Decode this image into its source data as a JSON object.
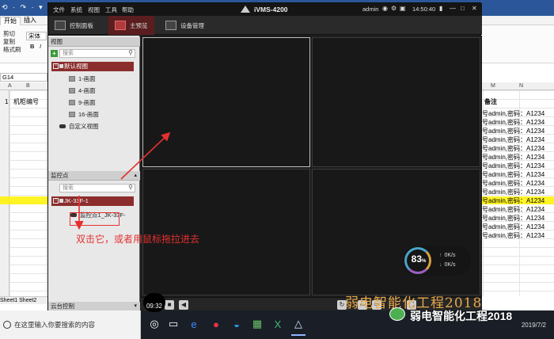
{
  "excel": {
    "quick_access": "⟲ · ↷ · ▾",
    "tabs": [
      "开始",
      "插入"
    ],
    "ribbon": {
      "cut": "剪切",
      "copy": "复制",
      "format_painter": "格式刷",
      "font": "宋体",
      "bold": "B",
      "italic": "I"
    },
    "name_box": "G14",
    "col_headers": [
      "A",
      "B",
      "M",
      "N"
    ],
    "cells": {
      "row1_no": "1",
      "row1_name": "机柜编号",
      "remark_header": "备注",
      "pw_rows": [
        "号admin,密码：A1234",
        "号admin,密码：A1234",
        "号admin,密码：A1234",
        "号admin,密码：A1234",
        "号admin,密码：A1234",
        "号admin,密码：A1234",
        "号admin,密码：A1234",
        "号admin,密码：A1234",
        "号admin,密码：A1234",
        "号admin,密码：A1234",
        "号admin,密码：A1234",
        "号admin,密码：A1234",
        "号admin,密码：A1234",
        "号admin,密码：A1234",
        "号admin,密码：A1234"
      ]
    },
    "sheets": [
      "Sheet1",
      "Sheet2"
    ]
  },
  "ivms": {
    "menus": [
      "文件",
      "系统",
      "视图",
      "工具",
      "帮助"
    ],
    "title": "iVMS-4200",
    "user": "admin",
    "time": "14:50:40",
    "tabs": [
      {
        "label": "控制面板"
      },
      {
        "label": "主预览"
      },
      {
        "label": "设备管理"
      }
    ],
    "view_section": {
      "header": "视图",
      "search_placeholder": "搜索",
      "root": "默认视图",
      "items": [
        "1-画面",
        "4-画面",
        "9-画面",
        "16-画面"
      ],
      "custom": "自定义视图"
    },
    "monitor_section": {
      "header": "监控点",
      "search_placeholder": "搜索",
      "root": "JK-33F-1",
      "item": "监控点1_JK-33F-"
    },
    "ptz_section": {
      "header": "云台控制"
    },
    "perf": {
      "percent": "83",
      "percent_unit": "%",
      "up": "0K/s",
      "down": "0K/s"
    }
  },
  "annotation": "双击它，或者用鼠标拖拉进去",
  "watermark": "弱电智能化工程2018",
  "watermark_brand": "弱电智能化工程2018",
  "overlay_time": "09:32",
  "taskbar": {
    "search_placeholder": "在这里输入你要搜索的内容",
    "date": "2019/7/2"
  },
  "colors": {
    "accent_red": "#e53030",
    "tab_active": "#5a1e20",
    "tree_root": "#8c2d2d",
    "watermark": "#e8a94a"
  }
}
